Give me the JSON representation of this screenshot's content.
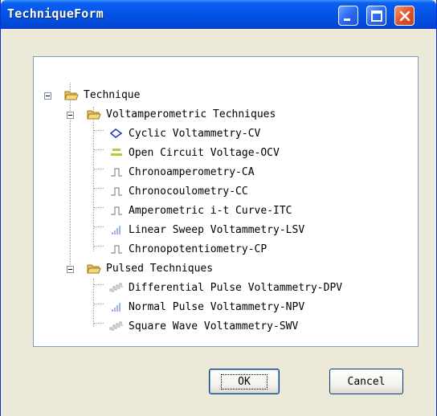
{
  "window": {
    "title": "TechniqueForm"
  },
  "titlebar_buttons": {
    "minimize": "minimize",
    "maximize": "maximize",
    "close": "close"
  },
  "tree": {
    "root": {
      "label": "Technique",
      "icon": "folder-open-icon"
    },
    "groups": [
      {
        "label": "Voltamperometric Techniques",
        "icon": "folder-open-icon",
        "items": [
          {
            "label": "Cyclic Voltammetry-CV",
            "icon": "cyclic-wave-icon"
          },
          {
            "label": "Open Circuit Voltage-OCV",
            "icon": "ocv-icon"
          },
          {
            "label": "Chronoamperometry-CA",
            "icon": "step-wave-icon"
          },
          {
            "label": "Chronocoulometry-CC",
            "icon": "step-wave-icon"
          },
          {
            "label": "Amperometric i-t Curve-ITC",
            "icon": "step-wave-icon"
          },
          {
            "label": "Linear Sweep Voltammetry-LSV",
            "icon": "bars-icon"
          },
          {
            "label": "Chronopotentiometry-CP",
            "icon": "step-wave-icon"
          }
        ]
      },
      {
        "label": "Pulsed Techniques",
        "icon": "folder-open-icon",
        "items": [
          {
            "label": "Differential Pulse Voltammetry-DPV",
            "icon": "pulse-wave-icon"
          },
          {
            "label": "Normal Pulse Voltammetry-NPV",
            "icon": "bars-icon"
          },
          {
            "label": "Square Wave Voltammetry-SWV",
            "icon": "pulse-wave-icon"
          }
        ]
      }
    ]
  },
  "buttons": {
    "ok": "OK",
    "cancel": "Cancel"
  },
  "colors": {
    "titlebar": "#0454e6",
    "face": "#ece9d8",
    "tree_border": "#7f9db9",
    "close": "#e0542c"
  }
}
